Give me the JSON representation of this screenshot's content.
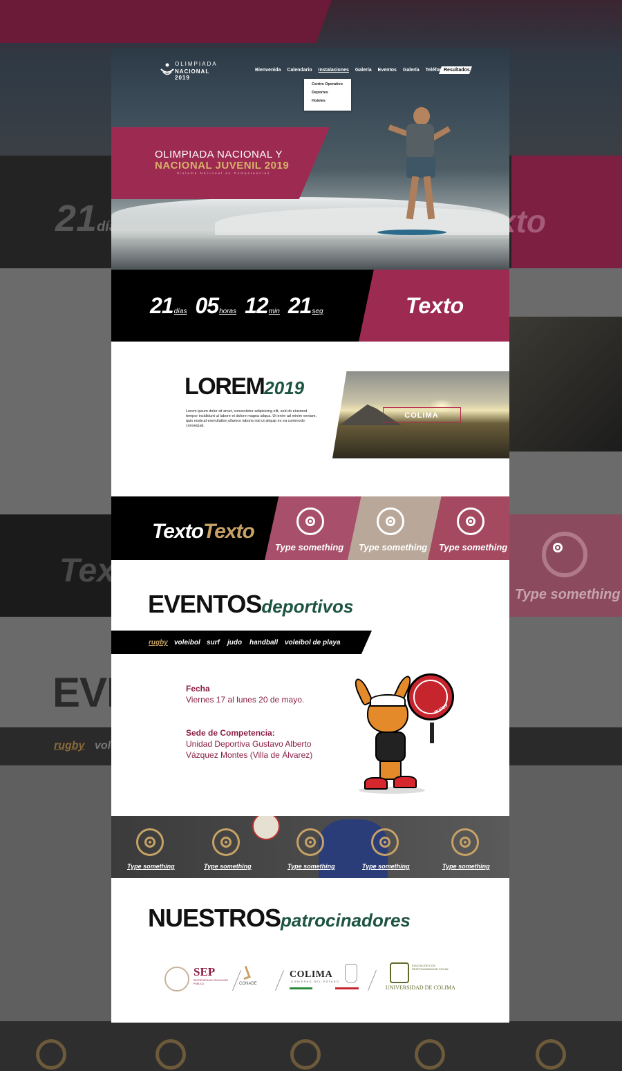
{
  "hero": {
    "logo_line1": "OLIMPIADA",
    "logo_line2": "NACIONAL 2019",
    "title_line1": "OLIMPIADA NACIONAL Y",
    "title_line2": "NACIONAL JUVENIL 2019",
    "subtitle": "Sistema Nacional de Competencias"
  },
  "nav": {
    "items": [
      "Bienvenida",
      "Calendario",
      "Instalaciones",
      "Galería",
      "Eventos",
      "Galería",
      "Teléfonos"
    ],
    "active": "Instalaciones",
    "results_label": "Resultados",
    "dropdown": [
      "Centro Operativo",
      "Deportes",
      "Hoteles"
    ]
  },
  "countdown": {
    "days": "21",
    "days_label": "días",
    "hours": "05",
    "hours_label": "horas",
    "minutes": "12",
    "minutes_label": "min",
    "seconds": "21",
    "seconds_label": "seg",
    "side_text": "Texto"
  },
  "intro": {
    "title_main": "LOREM",
    "title_accent": "2019",
    "body": "Lorem ipsum dolor sit amet, consectetur adipisicing elit, sed do eiusmod tempor incididunt ut labore et dolore magna aliqua. Ut enim ad minim veniam, quis nostrud exercitation ullamco laboris nisi ut aliquip ex ea commodo consequat.",
    "video_label": "COLIMA"
  },
  "strip": {
    "title_white": "Texto",
    "title_gold": "Texto",
    "cards": [
      "Type something",
      "Type something",
      "Type something"
    ]
  },
  "events": {
    "title_main": "EVENTOS",
    "title_accent": "deportivos",
    "tabs": [
      "rugby",
      "voleibol",
      "surf",
      "judo",
      "handball",
      "voleibol de playa"
    ],
    "active_tab": "rugby",
    "date_label": "Fecha",
    "date_value": "Viernes 17 al lunes 20 de mayo.",
    "venue_label": "Sede de Competencia:",
    "venue_value": "Unidad Deportiva Gustavo Alberto Vázquez Montes (Villa de Álvarez)",
    "mascot_badge": "RUGBY"
  },
  "ring_row": {
    "labels": [
      "Type something",
      "Type something",
      "Type something",
      "Type something",
      "Type something"
    ]
  },
  "sponsors": {
    "title_main": "NUESTROS",
    "title_accent": "patrocinadores",
    "sep_name": "SEP",
    "sep_sub": "SECRETARÍA DE EDUCACIÓN PÚBLICA",
    "conade": "CONADE",
    "colima": "COLIMA",
    "colima_sub": "GOBIERNO DEL ESTADO",
    "udc_top": "EDUCACIÓN CON RESPONSABILIDAD SOCIAL",
    "udc_name": "UNIVERSIDAD DE COLIMA"
  },
  "colors": {
    "magenta": "#9d2a51",
    "gold": "#c7a266",
    "green": "#1d5440",
    "black": "#000000"
  }
}
